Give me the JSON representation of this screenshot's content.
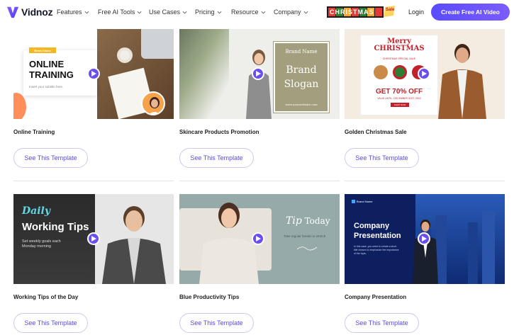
{
  "nav": {
    "logo_text": "Vidnoz",
    "items": [
      "Features",
      "Free AI Tools",
      "Use Cases",
      "Pricing",
      "Resource",
      "Company"
    ],
    "promo_text": "CHRISTMAS",
    "promo_badge": "Sale",
    "login": "Login",
    "cta": "Create Free AI Video"
  },
  "colors": {
    "accent": "#6b4ef0",
    "button_text": "#5a4be0",
    "christmas_red": "#c2202a"
  },
  "button_label": "See This Template",
  "cards": [
    {
      "title": "Online Training",
      "thumb": {
        "tag": "Brand Name",
        "heading_line1": "ONLINE",
        "heading_line2": "TRAINING",
        "subtitle": "Insert your subtitle here."
      }
    },
    {
      "title": "Skincare Products Promotion",
      "thumb": {
        "brand": "Brand Name",
        "slogan_line1": "Brand",
        "slogan_line2": "Slogan",
        "site": "www.yourwebsite.com"
      }
    },
    {
      "title": "Golden Christmas Sale",
      "thumb": {
        "merry": "Merry",
        "christmas": "CHRISTMAS",
        "sub": "CHRISTMAS SPECIAL SALE",
        "offer": "GET 70% OFF",
        "valid": "VALID UNTIL: DECEMBER 31ST, 2022",
        "shop": "SHOP NOW"
      }
    },
    {
      "title": "Working Tips of the Day",
      "thumb": {
        "daily": "Daily",
        "working": "Working Tips",
        "desc": "Set weekly goals each Monday morning"
      }
    },
    {
      "title": "Blue Productivity Tips",
      "thumb": {
        "tip": "Tip",
        "today": "Today",
        "note": "Take regular breaks to stretch"
      }
    },
    {
      "title": "Company Presentation",
      "thumb": {
        "brand": "Brand Name",
        "heading_line1": "Company",
        "heading_line2": "Presentation",
        "desc": "In this case, you need to create a short title chosen to emphasize the importance of the topic."
      }
    }
  ]
}
